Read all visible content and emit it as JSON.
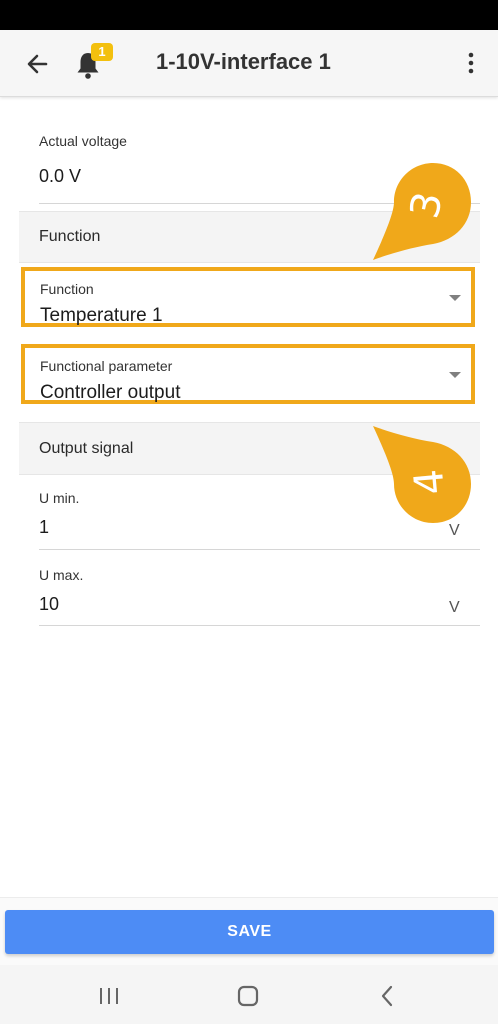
{
  "header": {
    "title": "1-10V-interface 1",
    "notification_count": "1",
    "icons": [
      "back-arrow-icon",
      "bell-icon",
      "more-vert-icon"
    ]
  },
  "actual_voltage": {
    "label": "Actual voltage",
    "value": "0.0 V"
  },
  "function_section": {
    "title": "Function",
    "function_select": {
      "label": "Function",
      "value": "Temperature 1"
    },
    "parameter_select": {
      "label": "Functional parameter",
      "value": "Controller output"
    }
  },
  "output_section": {
    "title": "Output signal",
    "u_min": {
      "label": "U min.",
      "value": "1",
      "unit": "V"
    },
    "u_max": {
      "label": "U max.",
      "value": "10",
      "unit": "V"
    }
  },
  "annotations": {
    "callout_top": "3",
    "callout_bottom": "4"
  },
  "save_label": "SAVE",
  "colors": {
    "highlight": "#f0a81a",
    "callout": "#f0a81a",
    "save_button": "#4d8cf5",
    "badge": "#f3c00e"
  },
  "navbar": {
    "icons": [
      "recent-apps-icon",
      "home-icon",
      "back-nav-icon"
    ]
  }
}
